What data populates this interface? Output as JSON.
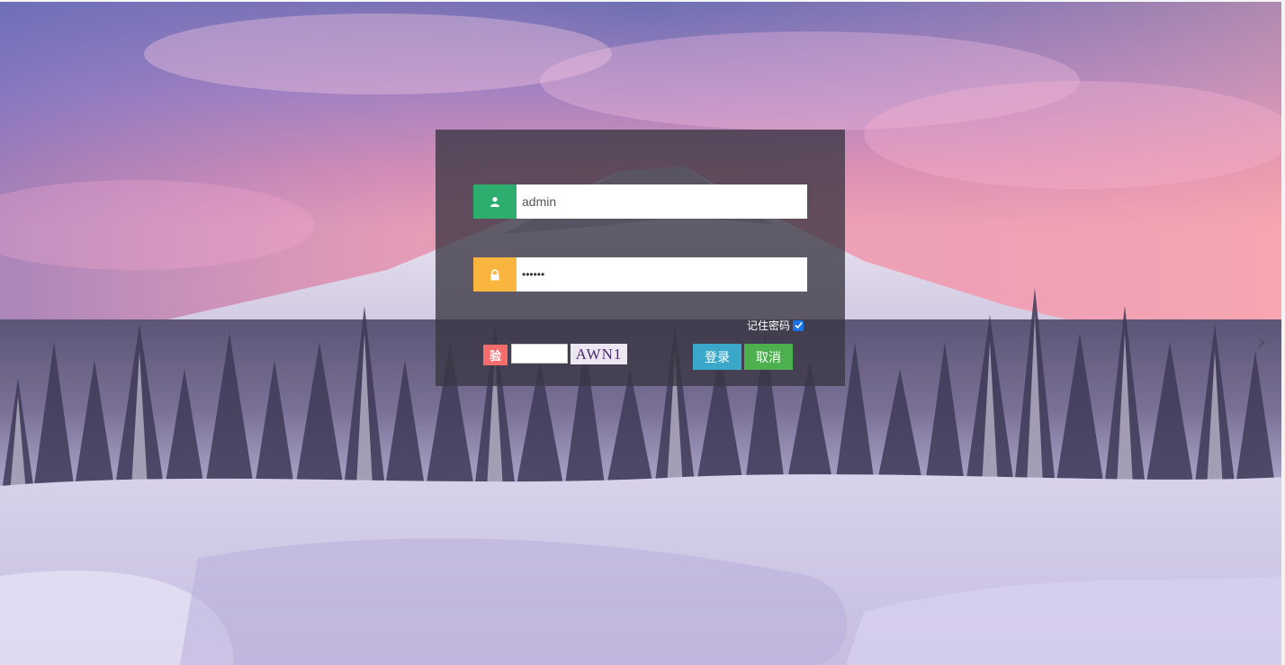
{
  "login": {
    "username_value": "admin",
    "password_value": "••••••",
    "remember_label": "记住密码",
    "remember_checked": true,
    "captcha_badge": "验",
    "captcha_input_value": "",
    "captcha_code": "AWN1",
    "login_button": "登录",
    "cancel_button": "取消"
  },
  "carousel": {
    "next_glyph": "›"
  },
  "icons": {
    "user": "user-icon",
    "lock": "lock-icon",
    "check": "check-icon"
  },
  "colors": {
    "user_addon": "#2dae6f",
    "lock_addon": "#f9b53e",
    "captcha_badge": "#f56c6c",
    "login_button": "#3ba8c9",
    "cancel_button": "#4cb04f"
  }
}
